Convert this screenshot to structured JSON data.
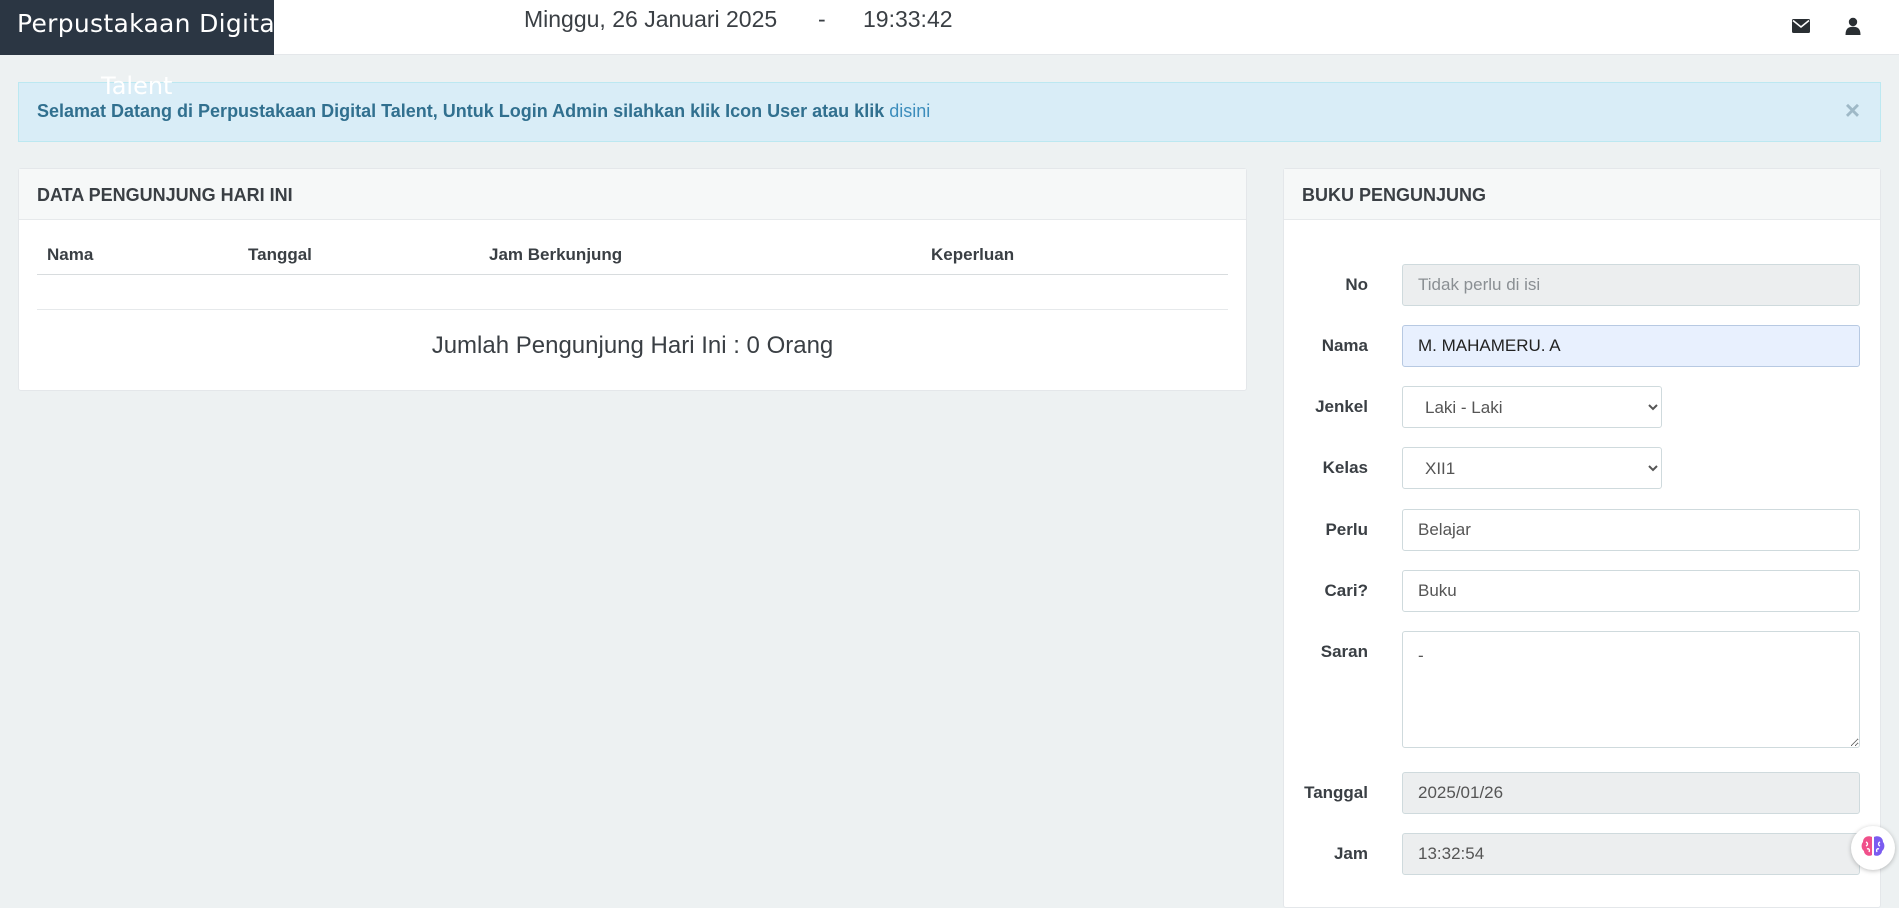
{
  "brand": {
    "line1": "Perpustakaan Digital",
    "line2": "Talent"
  },
  "header": {
    "date": "Minggu, 26 Januari 2025",
    "separator": "-",
    "time": "19:33:42",
    "icons": [
      "envelope-icon",
      "user-icon"
    ]
  },
  "alert": {
    "text": "Selamat Datang di Perpustakaan Digital Talent, Untuk Login Admin silahkan klik Icon User atau klik ",
    "link": "disini",
    "close": "×"
  },
  "visitors_panel": {
    "title": "DATA PENGUNJUNG HARI INI",
    "columns": [
      "Nama",
      "Tanggal",
      "Jam Berkunjung",
      "Keperluan"
    ],
    "count_text": "Jumlah Pengunjung Hari Ini : 0 Orang"
  },
  "guestbook": {
    "title": "BUKU PENGUNJUNG",
    "labels": {
      "no": "No",
      "nama": "Nama",
      "jenkel": "Jenkel",
      "kelas": "Kelas",
      "perlu": "Perlu",
      "cari": "Cari?",
      "saran": "Saran",
      "tanggal": "Tanggal",
      "jam": "Jam"
    },
    "fields": {
      "no_placeholder": "Tidak perlu di isi",
      "nama_value": "M. MAHAMERU. A",
      "jenkel_selected": "Laki - Laki",
      "kelas_selected": "XII1",
      "perlu_value": "Belajar",
      "cari_value": "Buku",
      "saran_value": "-",
      "tanggal_value": "2025/01/26",
      "jam_value": "13:32:54"
    }
  },
  "colors": {
    "brand_bg": "#2b3643",
    "page_bg": "#edf1f2",
    "alert_bg": "#d9edf7",
    "alert_text": "#31708f",
    "link": "#3c8dbc",
    "focused_input": "#e8f0fe"
  }
}
